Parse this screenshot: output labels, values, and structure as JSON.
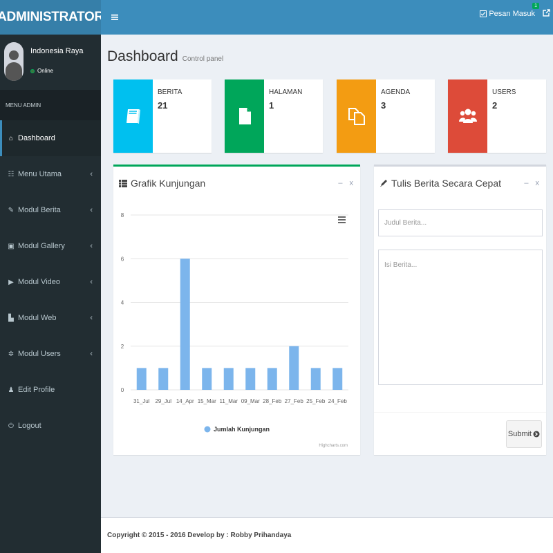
{
  "app": {
    "title": "ADMINISTRATOR"
  },
  "topbar": {
    "messages_label": "Pesan Masuk",
    "messages_badge": "1"
  },
  "sidebar": {
    "user": {
      "name": "Indonesia Raya",
      "status": "Online"
    },
    "header": "MENU ADMIN",
    "items": [
      {
        "label": "Dashboard",
        "icon": "dashboard-icon",
        "glyph": "⌂",
        "active": true,
        "has_arrow": false
      },
      {
        "label": "Menu Utama",
        "icon": "menu-icon",
        "glyph": "☷",
        "active": false,
        "has_arrow": true
      },
      {
        "label": "Modul Berita",
        "icon": "pencil-icon",
        "glyph": "✎",
        "active": false,
        "has_arrow": true
      },
      {
        "label": "Modul Gallery",
        "icon": "picture-icon",
        "glyph": "▣",
        "active": false,
        "has_arrow": true
      },
      {
        "label": "Modul Video",
        "icon": "play-icon",
        "glyph": "▶",
        "active": false,
        "has_arrow": true
      },
      {
        "label": "Modul Web",
        "icon": "file-icon",
        "glyph": "▙",
        "active": false,
        "has_arrow": true
      },
      {
        "label": "Modul Users",
        "icon": "cog-icon",
        "glyph": "✲",
        "active": false,
        "has_arrow": true
      },
      {
        "label": "Edit Profile",
        "icon": "user-icon",
        "glyph": "♟",
        "active": false,
        "has_arrow": false
      },
      {
        "label": "Logout",
        "icon": "power-icon",
        "glyph": "⏻",
        "active": false,
        "has_arrow": false
      }
    ],
    "arrow_glyph": "‹"
  },
  "content": {
    "title": "Dashboard",
    "subtitle": "Control panel"
  },
  "stats": [
    {
      "label": "BERITA",
      "value": "21",
      "color": "#00c0ef",
      "icon": "book-icon"
    },
    {
      "label": "HALAMAN",
      "value": "1",
      "color": "#00a65a",
      "icon": "page-icon"
    },
    {
      "label": "AGENDA",
      "value": "3",
      "color": "#f39c12",
      "icon": "copy-icon"
    },
    {
      "label": "USERS",
      "value": "2",
      "color": "#dd4b39",
      "icon": "users-icon"
    }
  ],
  "chart_panel": {
    "title": "Grafik Kunjungan",
    "minimize": "–",
    "close": "x",
    "credits": "Highcharts.com"
  },
  "chart_data": {
    "type": "bar",
    "categories": [
      "31_Jul",
      "29_Jul",
      "14_Apr",
      "15_Mar",
      "11_Mar",
      "09_Mar",
      "28_Feb",
      "27_Feb",
      "25_Feb",
      "24_Feb"
    ],
    "series": [
      {
        "name": "Jumlah Kunjungan",
        "values": [
          1,
          1,
          6,
          1,
          1,
          1,
          1,
          2,
          1,
          1
        ]
      }
    ],
    "yticks": [
      0,
      2,
      4,
      6,
      8
    ],
    "ylim": [
      0,
      8
    ],
    "grid": true,
    "legend": "bottom",
    "bar_color": "#7cb5ec"
  },
  "quick_panel": {
    "title": "Tulis Berita Secara Cepat",
    "minimize": "–",
    "close": "x",
    "title_placeholder": "Judul Berita...",
    "body_placeholder": "Isi Berita...",
    "submit_label": "Submit"
  },
  "footer": {
    "text": "Copyright © 2015 - 2016 Develop by : Robby Prihandaya"
  }
}
